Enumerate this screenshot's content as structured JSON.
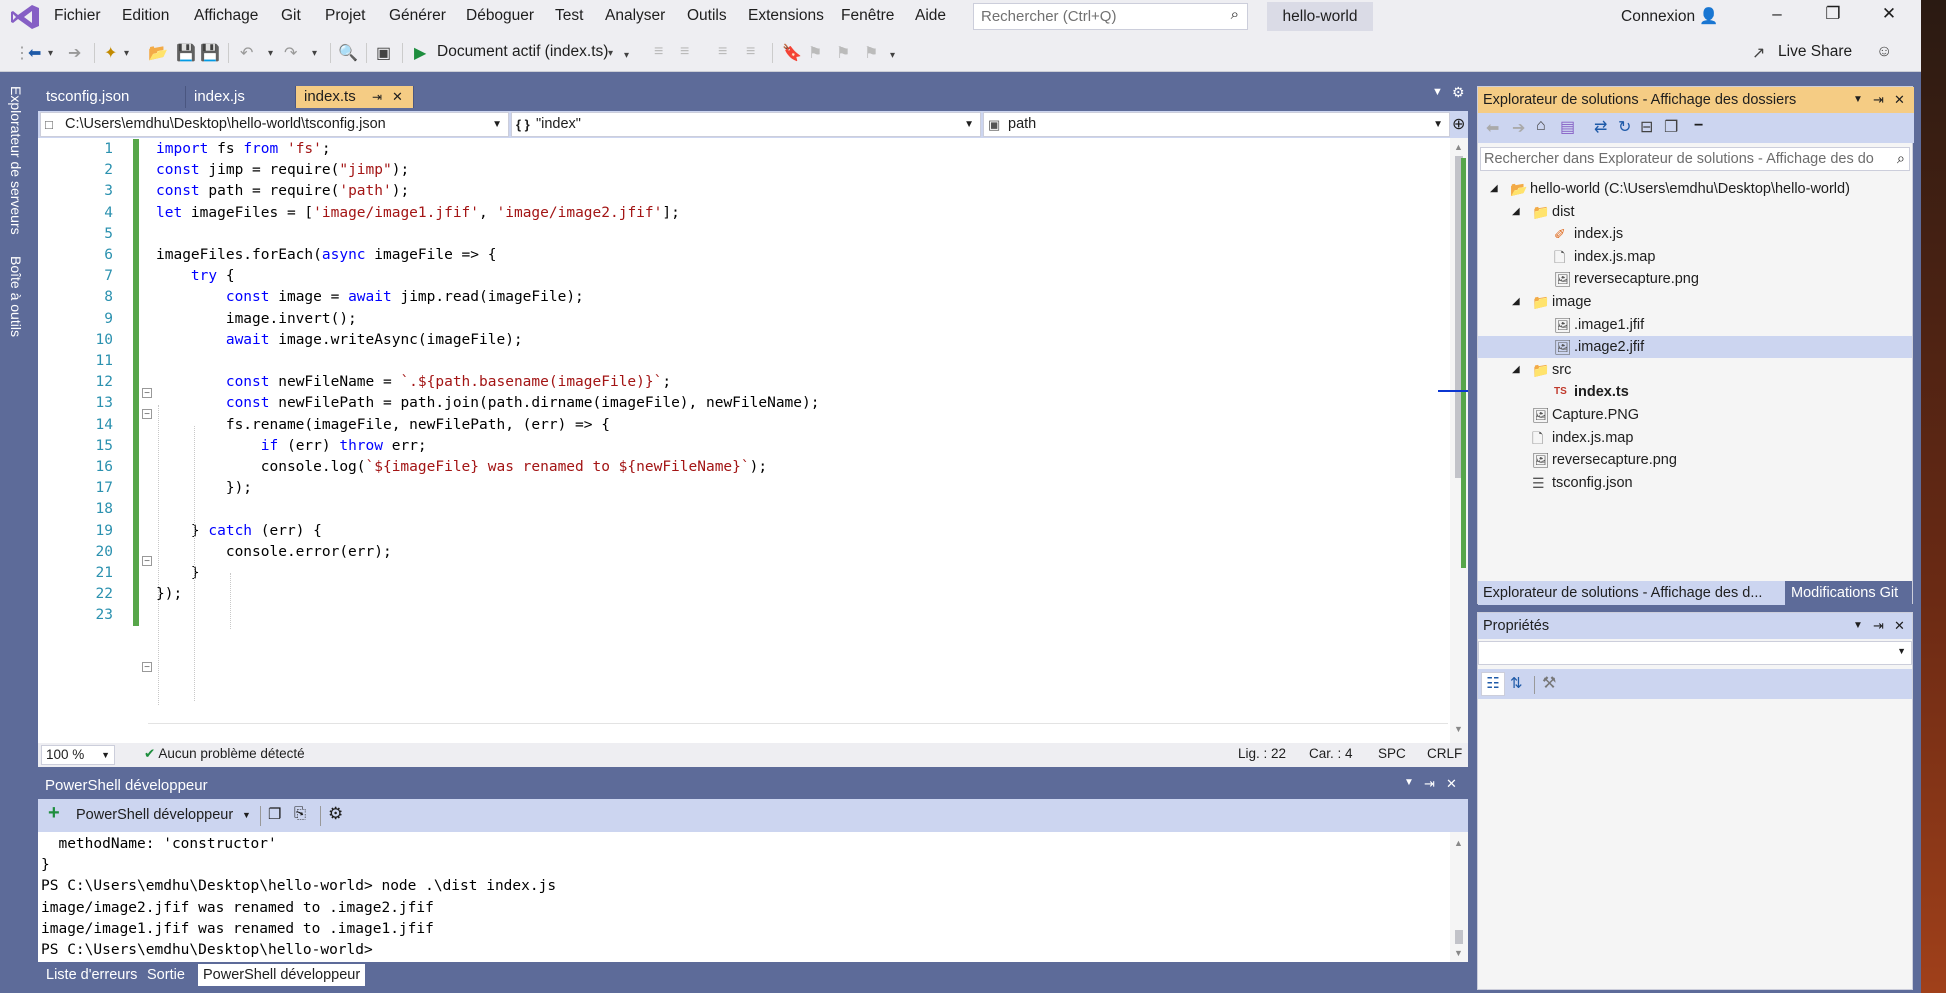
{
  "menu": [
    "Fichier",
    "Edition",
    "Affichage",
    "Git",
    "Projet",
    "Générer",
    "Déboguer",
    "Test",
    "Analyser",
    "Outils",
    "Extensions",
    "Fenêtre",
    "Aide"
  ],
  "search": {
    "placeholder": "Rechercher (Ctrl+Q)"
  },
  "solution_name": "hello-world",
  "account": "Connexion",
  "toolbar": {
    "run_label": "Document actif (index.ts)",
    "live_share": "Live Share"
  },
  "left_strip": {
    "server_explorer": "Explorateur de serveurs",
    "toolbox": "Boîte à outils"
  },
  "tabs": [
    {
      "label": "tsconfig.json",
      "active": false
    },
    {
      "label": "index.js",
      "active": false
    },
    {
      "label": "index.ts",
      "active": true
    }
  ],
  "nav": {
    "project": "C:\\Users\\emdhu\\Desktop\\hello-world\\tsconfig.json",
    "scope": "\"index\"",
    "member": "path"
  },
  "code_lines": [
    {
      "n": "1",
      "t": "import fs from 'fs';"
    },
    {
      "n": "2",
      "t": "const jimp = require(\"jimp\");"
    },
    {
      "n": "3",
      "t": "const path = require('path');"
    },
    {
      "n": "4",
      "t": "let imageFiles = ['image/image1.jfif', 'image/image2.jfif'];"
    },
    {
      "n": "5",
      "t": ""
    },
    {
      "n": "6",
      "t": "imageFiles.forEach(async imageFile => {"
    },
    {
      "n": "7",
      "t": "    try {"
    },
    {
      "n": "8",
      "t": "        const image = await jimp.read(imageFile);"
    },
    {
      "n": "9",
      "t": "        image.invert();"
    },
    {
      "n": "10",
      "t": "        await image.writeAsync(imageFile);"
    },
    {
      "n": "11",
      "t": ""
    },
    {
      "n": "12",
      "t": "        const newFileName = `.${path.basename(imageFile)}`;"
    },
    {
      "n": "13",
      "t": "        const newFilePath = path.join(path.dirname(imageFile), newFileName);"
    },
    {
      "n": "14",
      "t": "        fs.rename(imageFile, newFilePath, (err) => {"
    },
    {
      "n": "15",
      "t": "            if (err) throw err;"
    },
    {
      "n": "16",
      "t": "            console.log(`${imageFile} was renamed to ${newFileName}`);"
    },
    {
      "n": "17",
      "t": "        });"
    },
    {
      "n": "18",
      "t": ""
    },
    {
      "n": "19",
      "t": "    } catch (err) {"
    },
    {
      "n": "20",
      "t": "        console.error(err);"
    },
    {
      "n": "21",
      "t": "    }"
    },
    {
      "n": "22",
      "t": "});"
    },
    {
      "n": "23",
      "t": ""
    }
  ],
  "editor_status": {
    "zoom": "100 %",
    "issues": "Aucun problème détecté",
    "line": "Lig. : 22",
    "col": "Car. : 4",
    "spc": "SPC",
    "eol": "CRLF"
  },
  "ps": {
    "title": "PowerShell développeur",
    "toolbar_label": "PowerShell développeur",
    "lines": [
      "  methodName: 'constructor'",
      "}",
      "PS C:\\Users\\emdhu\\Desktop\\hello-world> node .\\dist index.js",
      "image/image2.jfif was renamed to .image2.jfif",
      "image/image1.jfif was renamed to .image1.jfif",
      "PS C:\\Users\\emdhu\\Desktop\\hello-world>"
    ],
    "bottom_tabs": [
      "Liste d'erreurs",
      "Sortie",
      "PowerShell développeur"
    ]
  },
  "solution_explorer": {
    "title": "Explorateur de solutions - Affichage des dossiers",
    "search_placeholder": "Rechercher dans Explorateur de solutions - Affichage des do",
    "tree": [
      {
        "label": "hello-world (C:\\Users\\emdhu\\Desktop\\hello-world)",
        "icon": "folder-open-icon",
        "level": 0,
        "expanded": true
      },
      {
        "label": "dist",
        "icon": "folder-icon",
        "level": 1,
        "expanded": true
      },
      {
        "label": "index.js",
        "icon": "js-file-icon",
        "level": 2
      },
      {
        "label": "index.js.map",
        "icon": "file-icon",
        "level": 2
      },
      {
        "label": "reversecapture.png",
        "icon": "image-icon",
        "level": 2
      },
      {
        "label": "image",
        "icon": "folder-icon",
        "level": 1,
        "expanded": true
      },
      {
        "label": ".image1.jfif",
        "icon": "image-icon",
        "level": 2
      },
      {
        "label": ".image2.jfif",
        "icon": "image-icon",
        "level": 2,
        "selected": true
      },
      {
        "label": "src",
        "icon": "folder-icon",
        "level": 1,
        "expanded": true
      },
      {
        "label": "index.ts",
        "icon": "ts-file-icon",
        "level": 2,
        "bold": true
      },
      {
        "label": "Capture.PNG",
        "icon": "image-icon",
        "level": 1
      },
      {
        "label": "index.js.map",
        "icon": "file-icon",
        "level": 1
      },
      {
        "label": "reversecapture.png",
        "icon": "image-icon",
        "level": 1
      },
      {
        "label": "tsconfig.json",
        "icon": "json-file-icon",
        "level": 1
      }
    ],
    "tab_active": "Explorateur de solutions - Affichage des d...",
    "tab_other": "Modifications Git"
  },
  "properties": {
    "title": "Propriétés"
  },
  "colors": {
    "accent_tab": "#f5cc84",
    "chrome": "#5d6b99",
    "keyword": "#0000ff",
    "string": "#a31515",
    "change_bar": "#57a64a"
  }
}
